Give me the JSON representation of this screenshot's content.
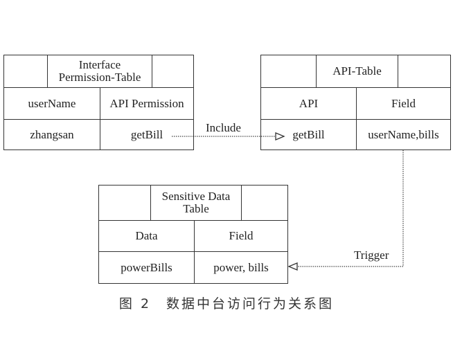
{
  "diagram": {
    "tables": {
      "interface_permission": {
        "title": "Interface\nPermission-Table",
        "title_line1": "Interface",
        "title_line2": "Permission-Table",
        "headers": [
          "userName",
          "API Permission"
        ],
        "row": [
          "zhangsan",
          "getBill"
        ]
      },
      "api": {
        "title": "API-Table",
        "headers": [
          "API",
          "Field"
        ],
        "row": [
          "getBill",
          "userName,bills"
        ]
      },
      "sensitive_data": {
        "title_line1": "Sensitive Data",
        "title_line2": "Table",
        "headers": [
          "Data",
          "Field"
        ],
        "row": [
          "powerBills",
          "power, bills"
        ]
      }
    },
    "edges": [
      {
        "from": "interface_permission.getBill",
        "to": "api.getBill",
        "label": "Include",
        "style": "dotted",
        "arrow": "open-triangle"
      },
      {
        "from": "api.userName,bills",
        "to": "sensitive_data.power, bills",
        "label": "Trigger",
        "style": "dotted",
        "arrow": "open-triangle"
      }
    ],
    "caption": "图 2　数据中台访问行为关系图"
  },
  "labels": {
    "include": "Include",
    "trigger": "Trigger"
  }
}
